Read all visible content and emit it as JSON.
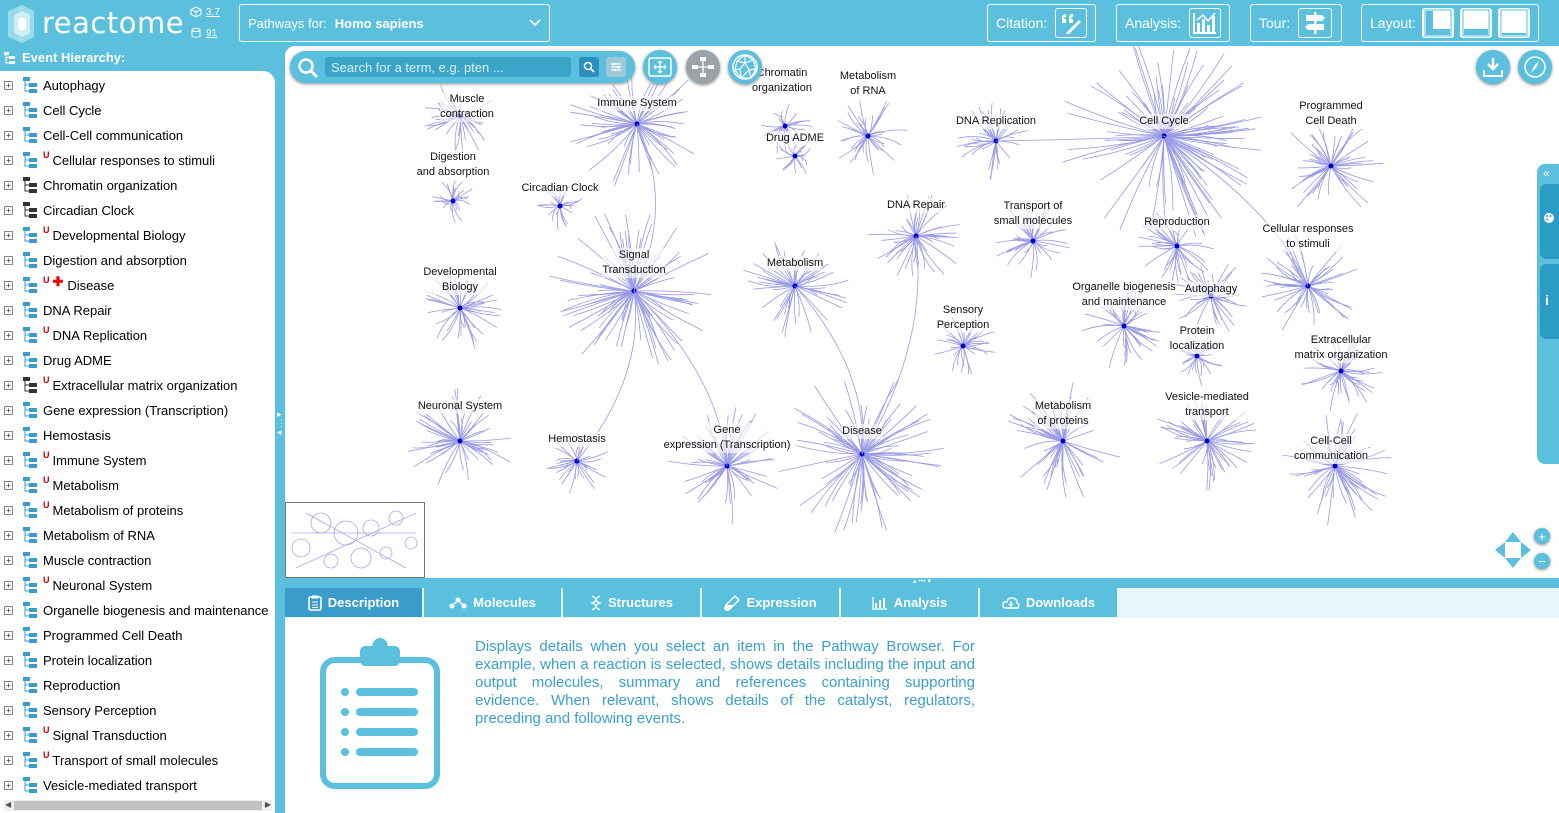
{
  "header": {
    "logo_text": "reactome",
    "version_number": "3.7",
    "version_count": "91",
    "species_label": "Pathways for:",
    "species_value": "Homo sapiens",
    "citation_label": "Citation:",
    "analysis_label": "Analysis:",
    "tour_label": "Tour:",
    "layout_label": "Layout:"
  },
  "sidebar": {
    "title": "Event Hierarchy:",
    "items": [
      {
        "label": "Autophagy",
        "badge": ""
      },
      {
        "label": "Cell Cycle",
        "badge": ""
      },
      {
        "label": "Cell-Cell communication",
        "badge": ""
      },
      {
        "label": "Cellular responses to stimuli",
        "badge": "U"
      },
      {
        "label": "Chromatin organization",
        "badge": ""
      },
      {
        "label": "Circadian Clock",
        "badge": ""
      },
      {
        "label": "Developmental Biology",
        "badge": "U"
      },
      {
        "label": "Digestion and absorption",
        "badge": ""
      },
      {
        "label": "Disease",
        "badge": "U"
      },
      {
        "label": "DNA Repair",
        "badge": ""
      },
      {
        "label": "DNA Replication",
        "badge": "U"
      },
      {
        "label": "Drug ADME",
        "badge": ""
      },
      {
        "label": "Extracellular matrix organization",
        "badge": "U"
      },
      {
        "label": "Gene expression (Transcription)",
        "badge": ""
      },
      {
        "label": "Hemostasis",
        "badge": ""
      },
      {
        "label": "Immune System",
        "badge": "U"
      },
      {
        "label": "Metabolism",
        "badge": "U"
      },
      {
        "label": "Metabolism of proteins",
        "badge": "U"
      },
      {
        "label": "Metabolism of RNA",
        "badge": ""
      },
      {
        "label": "Muscle contraction",
        "badge": ""
      },
      {
        "label": "Neuronal System",
        "badge": "U"
      },
      {
        "label": "Organelle biogenesis and maintenance",
        "badge": ""
      },
      {
        "label": "Programmed Cell Death",
        "badge": ""
      },
      {
        "label": "Protein localization",
        "badge": ""
      },
      {
        "label": "Reproduction",
        "badge": ""
      },
      {
        "label": "Sensory Perception",
        "badge": ""
      },
      {
        "label": "Signal Transduction",
        "badge": "U"
      },
      {
        "label": "Transport of small molecules",
        "badge": "U"
      },
      {
        "label": "Vesicle-mediated transport",
        "badge": ""
      }
    ]
  },
  "search": {
    "placeholder": "Search for a term, e.g. pten ..."
  },
  "diagram": {
    "labels": [
      {
        "text": "Muscle\ncontraction"
      },
      {
        "text": "Immune System"
      },
      {
        "text": "Chromatin\norganization"
      },
      {
        "text": "Metabolism\nof RNA"
      },
      {
        "text": "DNA Replication"
      },
      {
        "text": "Cell Cycle"
      },
      {
        "text": "Programmed\nCell Death"
      },
      {
        "text": "Digestion\nand absorption"
      },
      {
        "text": "Drug ADME"
      },
      {
        "text": "Circadian Clock"
      },
      {
        "text": "DNA Repair"
      },
      {
        "text": "Transport of\nsmall molecules"
      },
      {
        "text": "Reproduction"
      },
      {
        "text": "Cellular responses\nto stimuli"
      },
      {
        "text": "Signal\nTransduction"
      },
      {
        "text": "Metabolism"
      },
      {
        "text": "Developmental\nBiology"
      },
      {
        "text": "Organelle biogenesis\nand maintenance"
      },
      {
        "text": "Autophagy"
      },
      {
        "text": "Sensory\nPerception"
      },
      {
        "text": "Protein\nlocalization"
      },
      {
        "text": "Extracellular\nmatrix organization"
      },
      {
        "text": "Neuronal System"
      },
      {
        "text": "Metabolism\nof proteins"
      },
      {
        "text": "Vesicle-mediated\ntransport"
      },
      {
        "text": "Hemostasis"
      },
      {
        "text": "Gene\nexpression (Transcription)"
      },
      {
        "text": "Disease"
      },
      {
        "text": "Cell-Cell\ncommunication"
      }
    ]
  },
  "tabs": [
    {
      "label": "Description"
    },
    {
      "label": "Molecules"
    },
    {
      "label": "Structures"
    },
    {
      "label": "Expression"
    },
    {
      "label": "Analysis"
    },
    {
      "label": "Downloads"
    }
  ],
  "details": {
    "description": "Displays details when you select an item in the Pathway Browser. For example, when a reaction is selected, shows details including the input and output molecules, summary and references containing supporting evidence. When relevant, shows details of the catalyst, regulators, preceding and following events."
  },
  "colors": {
    "header_bg": "#5bc0de",
    "active_tab": "#3a9ccb",
    "graph_line": "#9a9ae6",
    "graph_node": "#0000cc",
    "description_text": "#3b9fd0",
    "badge_red": "#cc0000"
  }
}
